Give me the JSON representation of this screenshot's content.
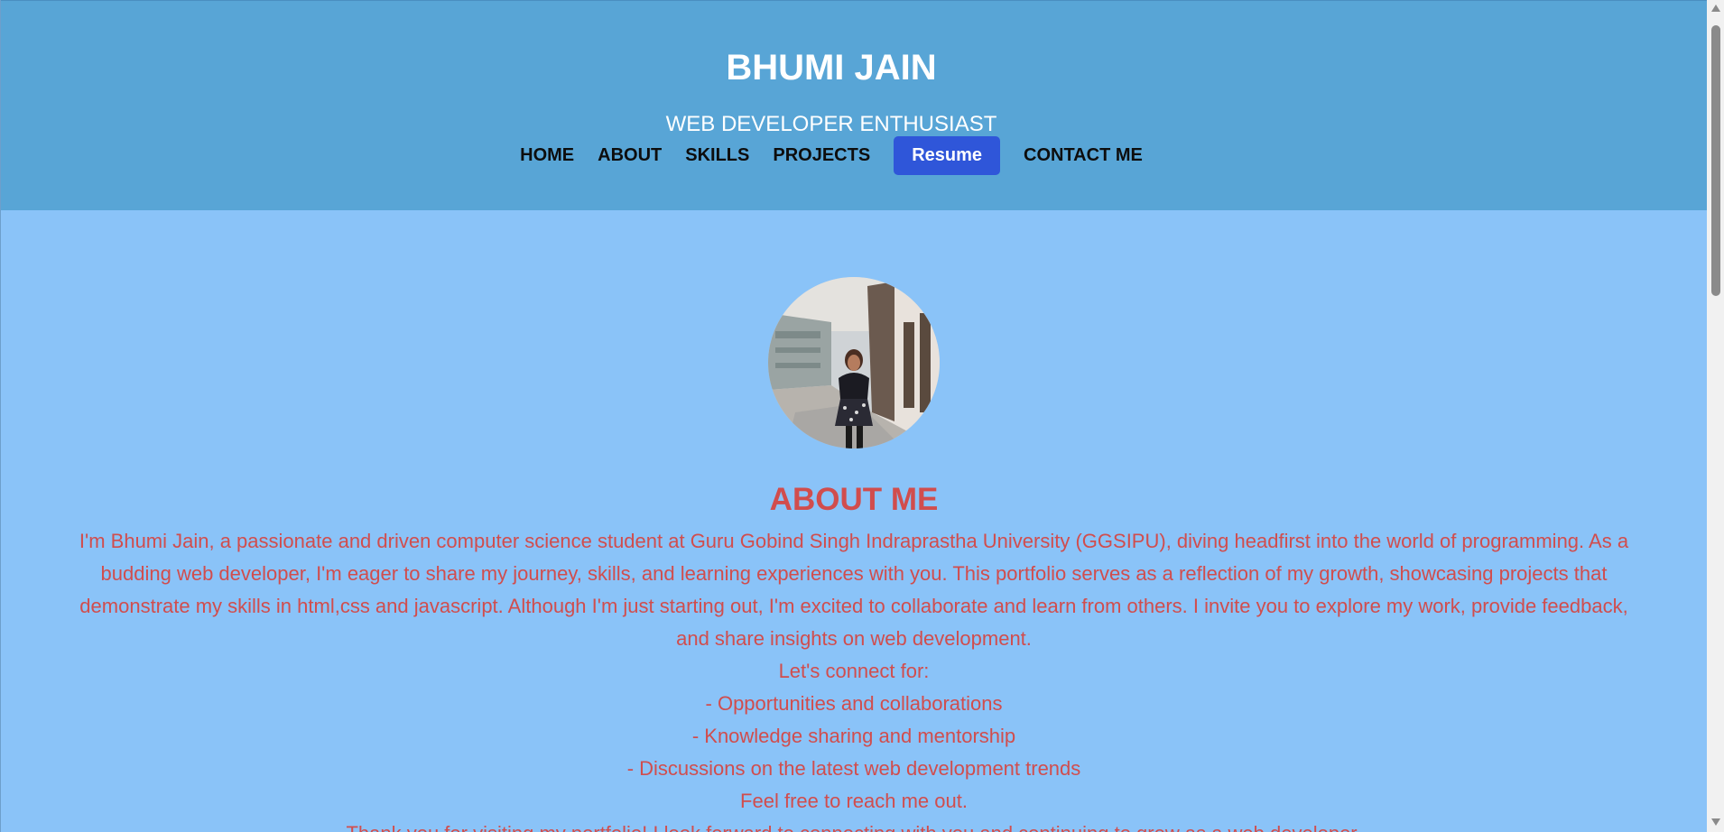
{
  "header": {
    "title": "BHUMI JAIN",
    "subtitle": "WEB DEVELOPER ENTHUSIAST"
  },
  "nav": {
    "items": [
      {
        "label": "HOME"
      },
      {
        "label": "ABOUT"
      },
      {
        "label": "SKILLS"
      },
      {
        "label": "PROJECTS"
      },
      {
        "label": "Resume"
      },
      {
        "label": "CONTACT ME"
      }
    ]
  },
  "about": {
    "heading": "ABOUT ME",
    "paragraph": "I'm Bhumi Jain, a passionate and driven computer science student at Guru Gobind Singh Indraprastha University (GGSIPU), diving headfirst into the world of programming. As a budding web developer, I'm eager to share my journey, skills, and learning experiences with you. This portfolio serves as a reflection of my growth, showcasing projects that demonstrate my skills in html,css and javascript. Although I'm just starting out, I'm excited to collaborate and learn from others. I invite you to explore my work, provide feedback, and share insights on web development.",
    "connect_intro": "Let's connect for:",
    "connect_items": [
      "- Opportunities and collaborations",
      "- Knowledge sharing and mentorship",
      "- Discussions on the latest web development trends"
    ],
    "reach_out": "Feel free to reach me out.",
    "thanks": "Thank you for visiting my portfolio! I look forward to connecting with you and continuing to grow as a web developer."
  },
  "colors": {
    "header_bg": "#58a5d6",
    "page_bg": "#8ac3f8",
    "accent_text": "#d14d4d",
    "resume_button": "#2f56d9"
  }
}
